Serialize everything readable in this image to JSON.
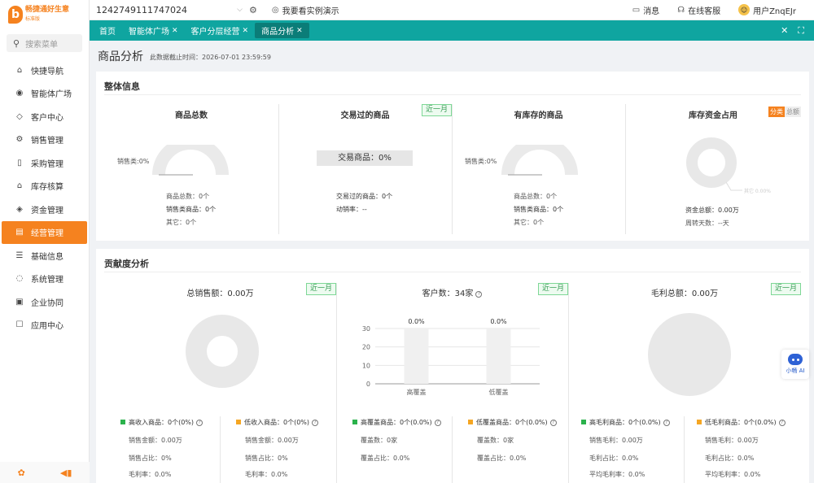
{
  "logo": {
    "mark": "b",
    "name": "畅捷通好生意",
    "sub": "标准版"
  },
  "sidebar": {
    "search_placeholder": "搜索菜单",
    "items": [
      {
        "label": "快捷导航",
        "icon": "home-icon"
      },
      {
        "label": "智能体广场",
        "icon": "ai-icon"
      },
      {
        "label": "客户中心",
        "icon": "diamond-icon"
      },
      {
        "label": "销售管理",
        "icon": "sales-icon"
      },
      {
        "label": "采购管理",
        "icon": "purchase-icon"
      },
      {
        "label": "库存核算",
        "icon": "warehouse-icon"
      },
      {
        "label": "资金管理",
        "icon": "money-icon"
      },
      {
        "label": "经营管理",
        "icon": "operation-icon"
      },
      {
        "label": "基础信息",
        "icon": "basic-info-icon"
      },
      {
        "label": "系统管理",
        "icon": "system-icon"
      },
      {
        "label": "企业协同",
        "icon": "collaboration-icon"
      },
      {
        "label": "应用中心",
        "icon": "apps-icon"
      }
    ],
    "active_index": 7
  },
  "topbar": {
    "tenant": "1242749111747024",
    "demo_label": "我要看实例演示",
    "messages": "消息",
    "service": "在线客服",
    "user": "用户ZnqEJr"
  },
  "tabs": [
    {
      "label": "首页",
      "closable": false
    },
    {
      "label": "智能体广场",
      "closable": true
    },
    {
      "label": "客户分层经营",
      "closable": true
    },
    {
      "label": "商品分析",
      "closable": true,
      "active": true
    }
  ],
  "page": {
    "title": "商品分析",
    "data_time": "此数据截止时间：2026-07-01 23:59:59"
  },
  "overview": {
    "title": "整体信息",
    "total": {
      "title": "商品总数",
      "side_label": "销售类:0%",
      "stats": [
        "商品总数：0个",
        "销售类商品：0个",
        "其它：0个"
      ]
    },
    "traded": {
      "title": "交易过的商品",
      "badge": "近一月",
      "box": "交易商品：0%",
      "stats": [
        "交易过的商品：0个",
        "动销率：--"
      ]
    },
    "stocked": {
      "title": "有库存的商品",
      "side_label": "销售类:0%",
      "stats": [
        "商品总数：0个",
        "销售类商品：0个",
        "其它：0个"
      ]
    },
    "capital": {
      "title": "库存资金占用",
      "toggle": [
        "分类",
        "总额"
      ],
      "pie_label": "其它 0.00%",
      "stats": [
        "资金总额：0.00万",
        "周转天数：--天"
      ]
    }
  },
  "contribution": {
    "title": "贡献度分析",
    "sales": {
      "title": "总销售额：0.00万",
      "badge": "近一月",
      "left": {
        "label": "高收入商品：0个(0%)",
        "rows": [
          "销售金额：0.00万",
          "销售占比：0%",
          "毛利率：0.0%"
        ]
      },
      "right": {
        "label": "低收入商品：0个(0%)",
        "rows": [
          "销售金额：0.00万",
          "销售占比：0%",
          "毛利率：0.0%"
        ]
      }
    },
    "customers": {
      "title": "客户数：34家",
      "badge": "近一月",
      "left": {
        "label": "高覆盖商品：0个(0.0%)",
        "rows": [
          "覆盖数：0家",
          "覆盖占比：0.0%"
        ]
      },
      "right": {
        "label": "低覆盖商品：0个(0.0%)",
        "rows": [
          "覆盖数：0家",
          "覆盖占比：0.0%"
        ]
      }
    },
    "profit": {
      "title": "毛利总额：0.00万",
      "badge": "近一月",
      "left": {
        "label": "高毛利商品：0个(0.0%)",
        "rows": [
          "销售毛利：0.00万",
          "毛利占比：0.0%",
          "平均毛利率：0.0%"
        ]
      },
      "right": {
        "label": "低毛利商品：0个(0.0%)",
        "rows": [
          "销售毛利：0.00万",
          "毛利占比：0.0%",
          "平均毛利率：0.0%"
        ]
      }
    }
  },
  "chart_data": {
    "type": "bar",
    "categories": [
      "高覆盖",
      "低覆盖"
    ],
    "values": [
      0,
      0
    ],
    "data_labels": [
      "0.0%",
      "0.0%"
    ],
    "yticks": [
      0,
      10,
      20,
      30
    ],
    "ylim": [
      0,
      30
    ],
    "grid": true
  },
  "colors": {
    "accent": "#f5821f",
    "teal": "#0fa5a0",
    "green": "#2bb24c",
    "orange": "#f5a623"
  },
  "robot": {
    "label": "小畅 AI"
  }
}
